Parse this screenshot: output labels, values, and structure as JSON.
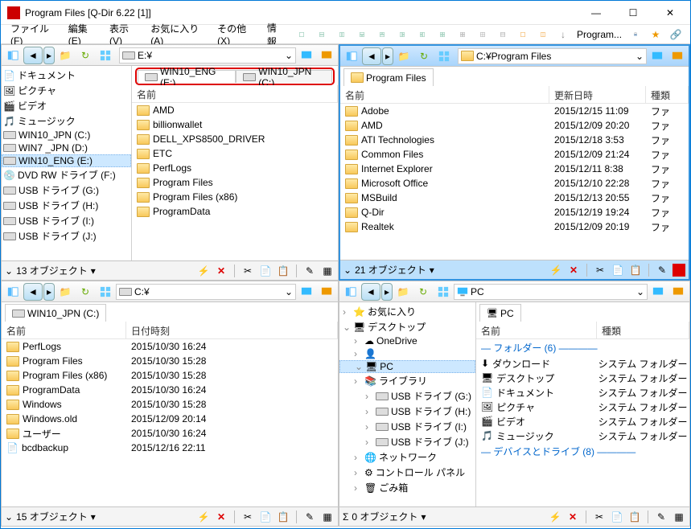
{
  "window": {
    "title": "Program Files  [Q-Dir 6.22 [1]]",
    "min": "—",
    "max": "☐",
    "close": "✕"
  },
  "menu": {
    "file": "ファイル(F)",
    "edit": "編集(E)",
    "view": "表示(V)",
    "fav": "お気に入り(A)",
    "other": "その他(X)",
    "info": "情報",
    "program": "Program..."
  },
  "p1": {
    "addr": "E:¥",
    "tree": [
      {
        "icon": "doc",
        "label": "ドキュメント"
      },
      {
        "icon": "pic",
        "label": "ピクチャ"
      },
      {
        "icon": "vid",
        "label": "ビデオ"
      },
      {
        "icon": "mus",
        "label": "ミュージック"
      },
      {
        "icon": "drv",
        "label": "WIN10_JPN (C:)"
      },
      {
        "icon": "drv",
        "label": "WIN7 _JPN  (D:)"
      },
      {
        "icon": "drv",
        "label": "WIN10_ENG (E:)",
        "sel": true
      },
      {
        "icon": "dvd",
        "label": "DVD RW ドライブ (F:)"
      },
      {
        "icon": "drv",
        "label": "USB ドライブ (G:)"
      },
      {
        "icon": "drv",
        "label": "USB ドライブ (H:)"
      },
      {
        "icon": "drv",
        "label": "USB ドライブ (I:)"
      },
      {
        "icon": "drv",
        "label": "USB ドライブ (J:)"
      }
    ],
    "tabs": [
      {
        "label": "WIN10_ENG (E:)",
        "active": true
      },
      {
        "label": "WIN10_JPN (C:)"
      }
    ],
    "col_name": "名前",
    "rows": [
      {
        "name": "AMD"
      },
      {
        "name": "billionwallet"
      },
      {
        "name": "DELL_XPS8500_DRIVER"
      },
      {
        "name": "ETC"
      },
      {
        "name": "PerfLogs"
      },
      {
        "name": "Program Files"
      },
      {
        "name": "Program Files (x86)"
      },
      {
        "name": "ProgramData"
      }
    ],
    "status": "13 オブジェクト"
  },
  "p2": {
    "addr": "C:¥Program Files",
    "tabs": [
      {
        "label": "Program Files",
        "active": true
      }
    ],
    "col_name": "名前",
    "col_date": "更新日時",
    "col_type": "種類",
    "rows": [
      {
        "name": "Adobe",
        "date": "2015/12/15 11:09",
        "type": "ファ"
      },
      {
        "name": "AMD",
        "date": "2015/12/09 20:20",
        "type": "ファ"
      },
      {
        "name": "ATI Technologies",
        "date": "2015/12/18 3:53",
        "type": "ファ"
      },
      {
        "name": "Common Files",
        "date": "2015/12/09 21:24",
        "type": "ファ"
      },
      {
        "name": "Internet Explorer",
        "date": "2015/12/11 8:38",
        "type": "ファ"
      },
      {
        "name": "Microsoft Office",
        "date": "2015/12/10 22:28",
        "type": "ファ"
      },
      {
        "name": "MSBuild",
        "date": "2015/12/13 20:55",
        "type": "ファ"
      },
      {
        "name": "Q-Dir",
        "date": "2015/12/19 19:24",
        "type": "ファ"
      },
      {
        "name": "Realtek",
        "date": "2015/12/09 20:19",
        "type": "ファ"
      }
    ],
    "status": "21 オブジェクト"
  },
  "p3": {
    "addr": "C:¥",
    "tabs": [
      {
        "label": "WIN10_JPN (C:)",
        "active": true
      }
    ],
    "col_name": "名前",
    "col_date": "日付時刻",
    "rows": [
      {
        "name": "PerfLogs",
        "date": "2015/10/30 16:24"
      },
      {
        "name": "Program Files",
        "date": "2015/10/30 15:28"
      },
      {
        "name": "Program Files (x86)",
        "date": "2015/10/30 15:28"
      },
      {
        "name": "ProgramData",
        "date": "2015/10/30 16:24"
      },
      {
        "name": "Windows",
        "date": "2015/10/30 15:28"
      },
      {
        "name": "Windows.old",
        "date": "2015/12/09 20:14"
      },
      {
        "name": "ユーザー",
        "date": "2015/10/30 16:24"
      },
      {
        "name": "bcdbackup",
        "date": "2015/12/16 22:11",
        "file": true
      }
    ],
    "status": "15 オブジェクト"
  },
  "p4": {
    "addr": "PC",
    "tree": [
      {
        "icon": "star",
        "label": "お気に入り",
        "ind": 0
      },
      {
        "icon": "desk",
        "label": "デスクトップ",
        "ind": 0,
        "exp": true
      },
      {
        "icon": "cloud",
        "label": "OneDrive",
        "ind": 1
      },
      {
        "icon": "user",
        "label": "",
        "ind": 1
      },
      {
        "icon": "pc",
        "label": "PC",
        "ind": 1,
        "sel": true,
        "exp": true
      },
      {
        "icon": "lib",
        "label": "ライブラリ",
        "ind": 1
      },
      {
        "icon": "drv",
        "label": "USB ドライブ (G:)",
        "ind": 2
      },
      {
        "icon": "drv",
        "label": "USB ドライブ (H:)",
        "ind": 2
      },
      {
        "icon": "drv",
        "label": "USB ドライブ (I:)",
        "ind": 2
      },
      {
        "icon": "drv",
        "label": "USB ドライブ (J:)",
        "ind": 2
      },
      {
        "icon": "net",
        "label": "ネットワーク",
        "ind": 1
      },
      {
        "icon": "cp",
        "label": "コントロール パネル",
        "ind": 1
      },
      {
        "icon": "bin",
        "label": "ごみ箱",
        "ind": 1
      }
    ],
    "tabs": [
      {
        "label": "PC",
        "active": true
      }
    ],
    "col_name": "名前",
    "col_type": "種類",
    "cat1": "フォルダー (6)",
    "rows": [
      {
        "icon": "dl",
        "name": "ダウンロード",
        "type": "システム フォルダー"
      },
      {
        "icon": "desk",
        "name": "デスクトップ",
        "type": "システム フォルダー"
      },
      {
        "icon": "doc",
        "name": "ドキュメント",
        "type": "システム フォルダー"
      },
      {
        "icon": "pic",
        "name": "ピクチャ",
        "type": "システム フォルダー"
      },
      {
        "icon": "vid",
        "name": "ビデオ",
        "type": "システム フォルダー"
      },
      {
        "icon": "mus",
        "name": "ミュージック",
        "type": "システム フォルダー"
      }
    ],
    "cat2": "デバイスとドライブ (8)",
    "status": "0 オブジェクト"
  }
}
